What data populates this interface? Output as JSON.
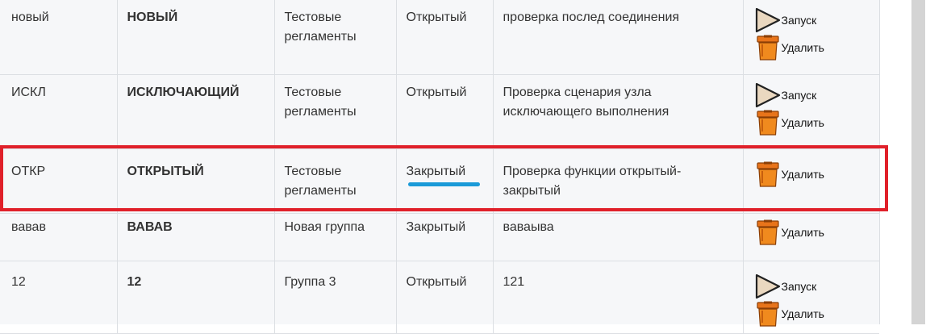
{
  "actions": {
    "run_label": "Запуск",
    "delete_label": "Удалить"
  },
  "rows": [
    {
      "code": "новый",
      "name": "НОВЫЙ",
      "group": "Тестовые регламенты",
      "status": "Открытый",
      "description": "проверка послед соединения",
      "has_run": true
    },
    {
      "code": "ИСКЛ",
      "name": "ИСКЛЮЧАЮЩИЙ",
      "group": "Тестовые регламенты",
      "status": "Открытый",
      "description": "Проверка сценария узла исключающего выполнения",
      "has_run": true
    },
    {
      "code": "ОТКР",
      "name": "ОТКРЫТЫЙ",
      "group": "Тестовые регламенты",
      "status": "Закрытый",
      "description": "Проверка функции открытый-закрытый",
      "has_run": false
    },
    {
      "code": "вавав",
      "name": "ВАВАВ",
      "group": "Новая группа",
      "status": "Закрытый",
      "description": "ваваыва",
      "has_run": false
    },
    {
      "code": "12",
      "name": "12",
      "group": "Группа 3",
      "status": "Открытый",
      "description": "121",
      "has_run": true
    }
  ],
  "annotations": {
    "highlight_color": "#e0202a",
    "underline_color": "#1a9ad8"
  },
  "icons": {
    "run": "play-icon",
    "delete": "trash-icon"
  }
}
